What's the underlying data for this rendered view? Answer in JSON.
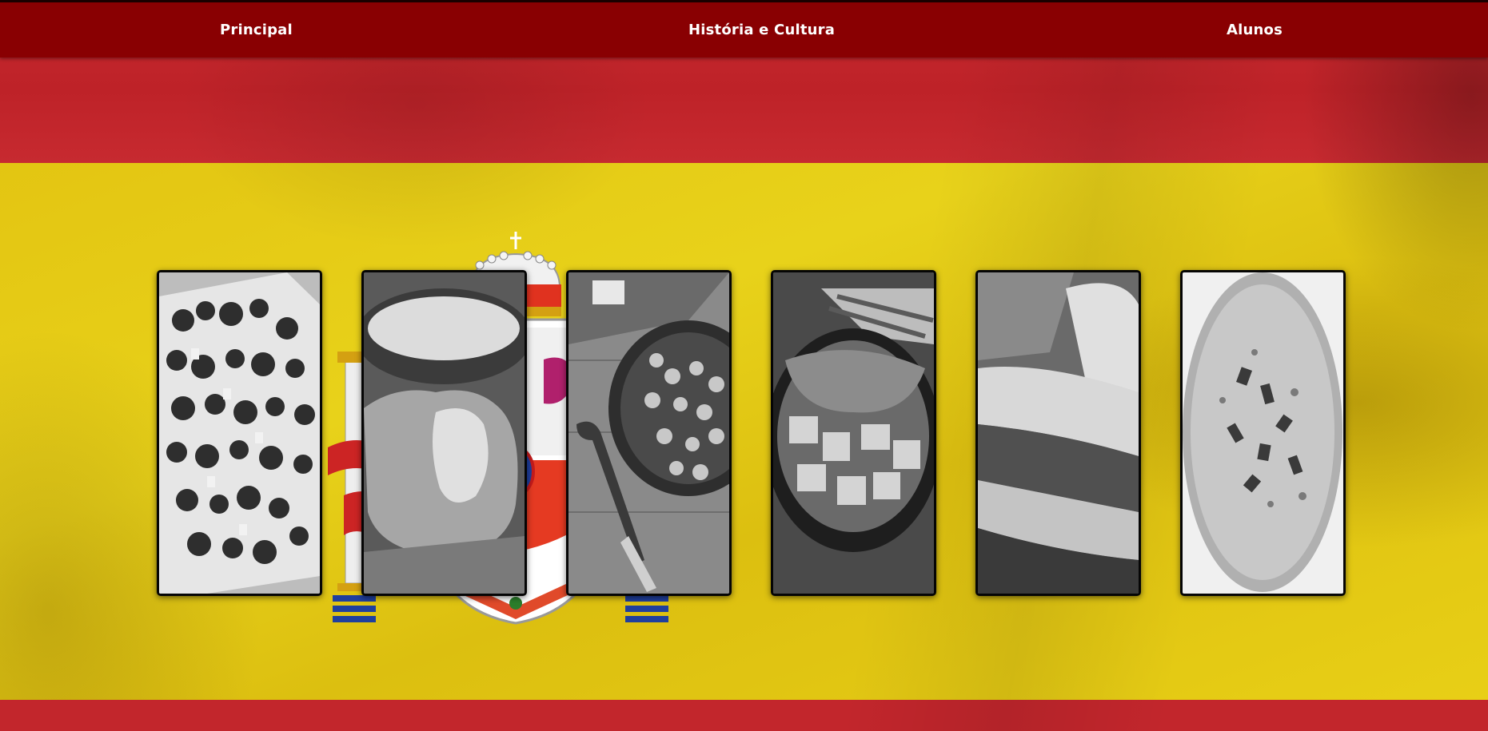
{
  "navbar": {
    "links": [
      {
        "label": "Principal"
      },
      {
        "label": "História e Cultura"
      },
      {
        "label": "Alunos"
      }
    ]
  },
  "background": {
    "flag_colors": {
      "red": "#c4262c",
      "yellow": "#e6c514"
    }
  },
  "cards": [
    {
      "image": "skewers-photo-grayscale"
    },
    {
      "image": "croquettes-photo-grayscale"
    },
    {
      "image": "chickpea-stew-photo-grayscale"
    },
    {
      "image": "patatas-bravas-photo-grayscale"
    },
    {
      "image": "sandwich-photo-grayscale"
    },
    {
      "image": "cold-soup-photo-grayscale"
    }
  ],
  "colors": {
    "navbar_bg": "#890002",
    "nav_text": "#ffffff",
    "card_border": "#050505"
  }
}
